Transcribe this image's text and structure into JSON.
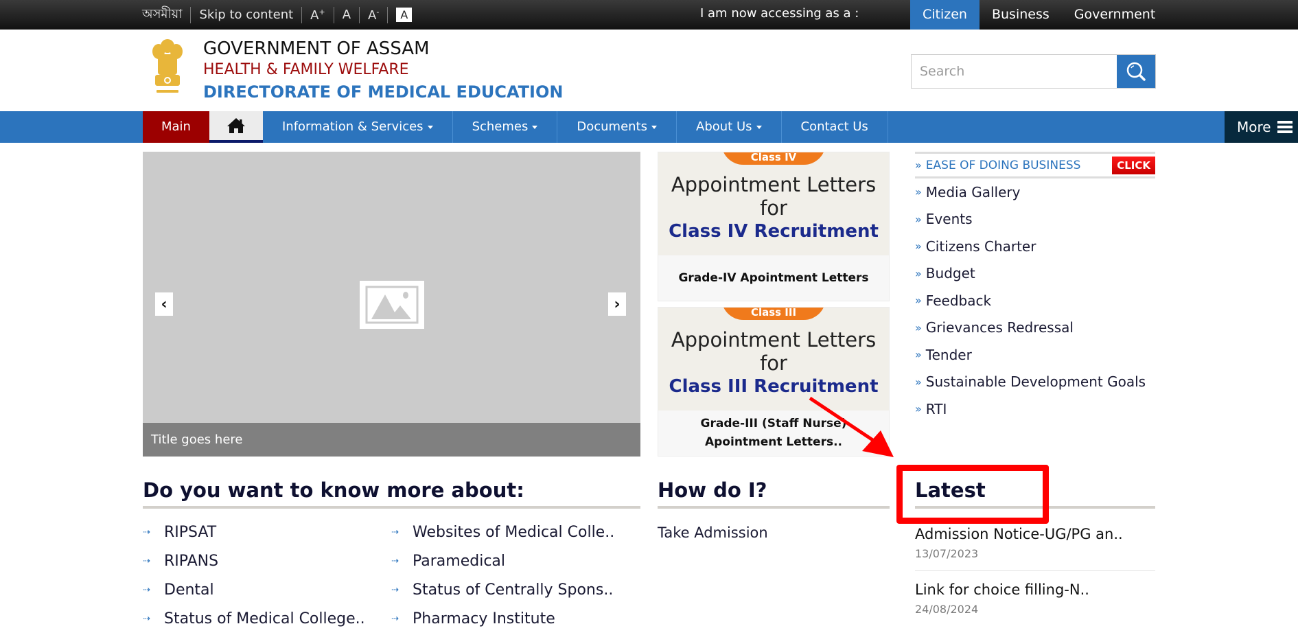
{
  "topbar": {
    "language": "অসমীয়া",
    "skip": "Skip to content",
    "font_increase": "A+",
    "font_normal": "A",
    "font_decrease": "A-",
    "contrast": "A",
    "access_label": "I am now accessing as a :",
    "roles": [
      {
        "label": "Citizen",
        "active": true
      },
      {
        "label": "Business",
        "active": false
      },
      {
        "label": "Government",
        "active": false
      }
    ]
  },
  "header": {
    "line1": "GOVERNMENT OF ASSAM",
    "line2": "HEALTH & FAMILY WELFARE",
    "line3": "DIRECTORATE OF MEDICAL EDUCATION",
    "emblem_icon": "state-emblem-icon",
    "search_placeholder": "Search",
    "search_icon": "search-icon"
  },
  "nav": {
    "items": [
      {
        "label": "Main",
        "dropdown": false
      },
      {
        "label": "",
        "icon": "home-icon",
        "dropdown": false
      },
      {
        "label": "Information & Services",
        "dropdown": true
      },
      {
        "label": "Schemes",
        "dropdown": true
      },
      {
        "label": "Documents",
        "dropdown": true
      },
      {
        "label": "About Us",
        "dropdown": true
      },
      {
        "label": "Contact Us",
        "dropdown": false
      }
    ],
    "more": "More"
  },
  "slider": {
    "caption": "Title goes here",
    "prev": "‹",
    "next": "›"
  },
  "cards": [
    {
      "badge": "Class IV",
      "line1": "Appointment Letters",
      "line2": "for",
      "line3": "Class IV Recruitment",
      "label": "Grade-IV Apointment Letters"
    },
    {
      "badge": "Class III",
      "line1": "Appointment Letters",
      "line2": "for",
      "line3": "Class III Recruitment",
      "label": "Grade-III (Staff Nurse) Apointment Letters.."
    }
  ],
  "right_list": {
    "bullet": "»",
    "featured": {
      "label": "EASE OF DOING BUSINESS",
      "badge": "CLICK"
    },
    "items": [
      "Media Gallery",
      "Events",
      "Citizens Charter",
      "Budget",
      "Feedback",
      "Grievances Redressal",
      "Tender",
      "Sustainable Development Goals",
      "RTI"
    ]
  },
  "know_more": {
    "heading": "Do you want to know more about:",
    "arrow": "⇢",
    "items": [
      "RIPSAT",
      "Websites of Medical Colle..",
      "RIPANS",
      "Paramedical",
      "Dental",
      "Status of Centrally Spons..",
      "Status of Medical College..",
      "Pharmacy Institute"
    ]
  },
  "how_do_i": {
    "heading": "How do I?",
    "items": [
      "Take Admission"
    ]
  },
  "latest": {
    "heading": "Latest",
    "items": [
      {
        "title": "Admission Notice-UG/PG an..",
        "date": "13/07/2023"
      },
      {
        "title": "Link for choice filling-N..",
        "date": "24/08/2024"
      }
    ]
  },
  "annotation": {
    "color": "#ff0000",
    "target": "Latest"
  },
  "colors": {
    "brand_blue": "#2c74bd",
    "main_red": "#9c0000",
    "more_dark": "#07293d",
    "header_red": "#9c0c0c"
  }
}
